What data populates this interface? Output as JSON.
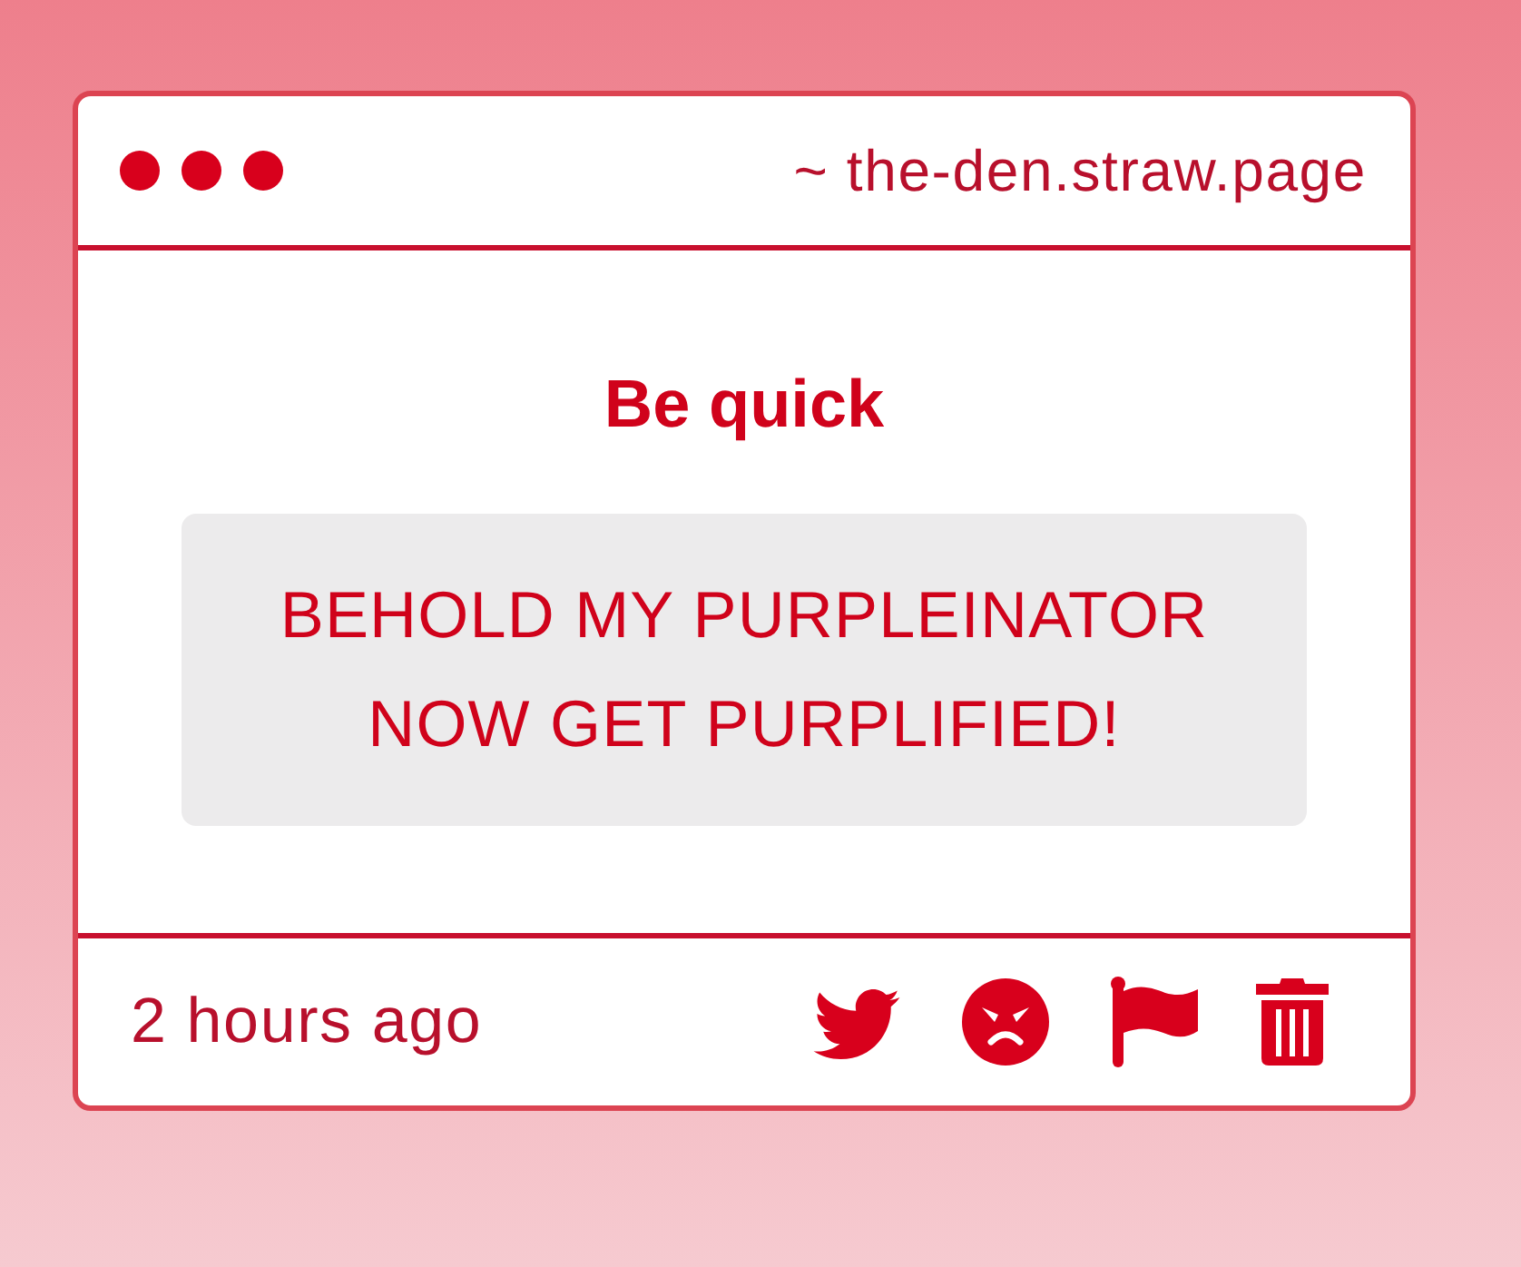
{
  "window": {
    "address": "~ the-den.straw.page"
  },
  "post": {
    "title": "Be quick",
    "message": "BEHOLD MY PURPLEINATOR\nNOW GET PURPLIFIED!"
  },
  "footer": {
    "time": "2 hours ago"
  }
}
